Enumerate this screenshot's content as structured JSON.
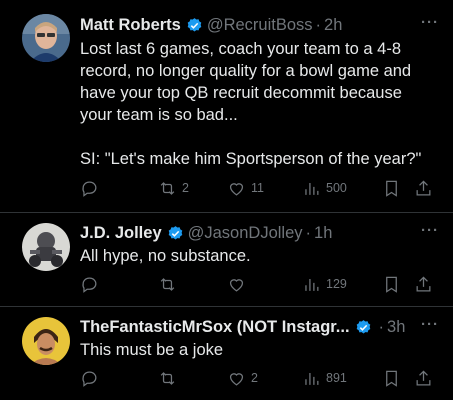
{
  "tweets": [
    {
      "name": "Matt Roberts",
      "handle": "@RecruitBoss",
      "time": "2h",
      "body_lines": [
        "Lost last 6 games, coach your team to a 4-8 record, no longer quality for a bowl game and have your top QB recruit decommit because your team is so bad...",
        "SI: \"Let's make him Sportsperson of the year?\""
      ],
      "replies": "",
      "retweets": "2",
      "likes": "11",
      "views": "500"
    },
    {
      "name": "J.D. Jolley",
      "handle": "@JasonDJolley",
      "time": "1h",
      "body_lines": [
        "All hype, no substance."
      ],
      "replies": "",
      "retweets": "",
      "likes": "",
      "views": "129"
    },
    {
      "name": "TheFantasticMrSox (NOT Instagr...",
      "handle": "",
      "time": "3h",
      "body_lines": [
        "This must be a joke"
      ],
      "replies": "",
      "retweets": "",
      "likes": "2",
      "views": "891"
    }
  ],
  "colors": {
    "verified": "#1d9bf0",
    "muted": "#71767b",
    "text": "#e7e9ea",
    "divider": "#2f3336"
  },
  "icons": [
    "reply-icon",
    "retweet-icon",
    "like-icon",
    "views-icon",
    "bookmark-icon",
    "share-icon",
    "more-icon",
    "verified-icon"
  ]
}
